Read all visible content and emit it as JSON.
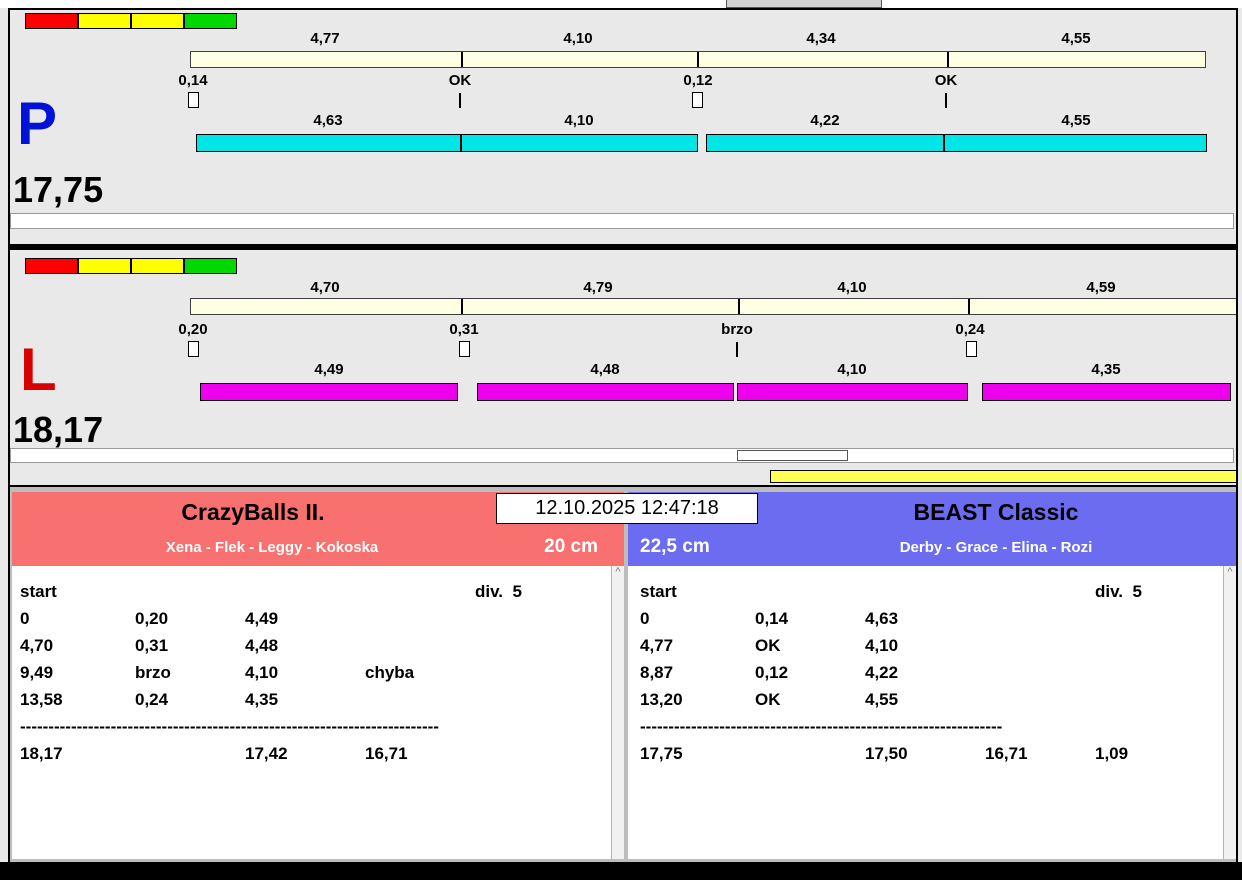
{
  "ui": {
    "scroll_up_glyph": "^"
  },
  "timestamp": "12.10.2025 12:47:18",
  "status_lights": [
    "#ff0000",
    "#ffff00",
    "#ffff00",
    "#00d800"
  ],
  "colors": {
    "lane_p_bar": "#00e6e6",
    "lane_l_bar": "#ee00ee",
    "letter_p": "#0011d8",
    "letter_l": "#d80000",
    "hdr_left": "#f87070",
    "hdr_right": "#6c6cf0",
    "yellow_bar": "#ffff55"
  },
  "lanes": [
    {
      "letter": "P",
      "total": "17,75",
      "upper_segments": [
        "4,77",
        "4,10",
        "4,34",
        "4,55"
      ],
      "exchange_marks": [
        "0,14",
        "OK",
        "0,12",
        "OK"
      ],
      "lower_segments": [
        "4,63",
        "4,10",
        "4,22",
        "4,55"
      ]
    },
    {
      "letter": "L",
      "total": "18,17",
      "upper_segments": [
        "4,70",
        "4,79",
        "4,10",
        "4,59"
      ],
      "exchange_marks": [
        "0,20",
        "0,31",
        "brzo",
        "0,24"
      ],
      "lower_segments": [
        "4,49",
        "4,48",
        "4,10",
        "4,35"
      ]
    }
  ],
  "panels": [
    {
      "team": "CrazyBalls II.",
      "dogs": "Xena - Flek - Leggy - Kokoska",
      "height": "20 cm",
      "rows": [
        [
          "start",
          "",
          "",
          "",
          "div.  5"
        ],
        [
          "0",
          "0,20",
          "4,49",
          "",
          ""
        ],
        [
          "4,70",
          "0,31",
          "4,48",
          "",
          ""
        ],
        [
          "9,49",
          "brzo",
          "4,10",
          "chyba",
          ""
        ],
        [
          "13,58",
          "0,24",
          "4,35",
          "",
          ""
        ],
        [
          "--------------------------------------------------------------------------"
        ],
        [
          "18,17",
          "",
          "17,42",
          "16,71",
          ""
        ]
      ]
    },
    {
      "team": "BEAST Classic",
      "dogs": "Derby - Grace - Elina - Rozi",
      "height": "22,5 cm",
      "rows": [
        [
          "start",
          "",
          "",
          "",
          "div.  5"
        ],
        [
          "0",
          "0,14",
          "4,63",
          "",
          ""
        ],
        [
          "4,77",
          "OK",
          "4,10",
          "",
          ""
        ],
        [
          "8,87",
          "0,12",
          "4,22",
          "",
          ""
        ],
        [
          "13,20",
          "OK",
          "4,55",
          "",
          ""
        ],
        [
          "----------------------------------------------------------------"
        ],
        [
          "17,75",
          "",
          "17,50",
          "16,71",
          "1,09"
        ]
      ]
    }
  ]
}
